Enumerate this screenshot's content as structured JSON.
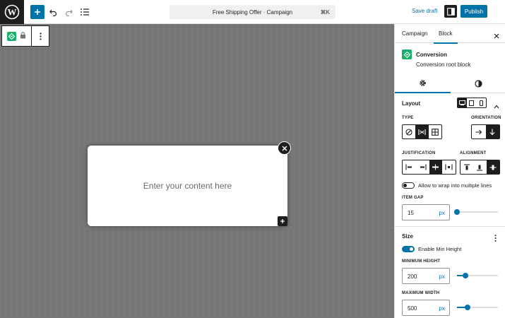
{
  "topbar": {
    "document_title": "Free Shipping Offer · Campaign",
    "shortcut": "⌘K",
    "save_draft": "Save draft",
    "publish": "Publish"
  },
  "canvas": {
    "popup_placeholder": "Enter your content here"
  },
  "sidebar": {
    "tabs": [
      {
        "label": "Campaign",
        "active": false
      },
      {
        "label": "Block",
        "active": true
      }
    ],
    "block": {
      "name": "Conversion",
      "description": "Conversion root block"
    },
    "layout": {
      "title": "Layout",
      "device": "desktop",
      "type_label": "TYPE",
      "type_selected": "flex",
      "orientation_label": "ORIENTATION",
      "orientation_selected": "vertical",
      "justification_label": "JUSTIFICATION",
      "justification_selected": "center",
      "alignment_label": "ALIGNMENT",
      "alignment_selected": "stretch",
      "wrap_label": "Allow to wrap into multiple lines",
      "wrap_enabled": false,
      "gap_label": "ITEM GAP",
      "gap_value": "15",
      "gap_unit": "px",
      "gap_slider": 0.0
    },
    "size": {
      "title": "Size",
      "min_height_toggle_label": "Enable Min Height",
      "min_height_enabled": true,
      "min_height_label": "MINIMUM HEIGHT",
      "min_height_value": "200",
      "min_height_unit": "px",
      "min_height_slider": 0.2,
      "max_width_label": "MAXIMUM WIDTH",
      "max_width_value": "500",
      "max_width_unit": "px",
      "max_width_slider": 0.25
    }
  },
  "colors": {
    "accent": "#0073aa",
    "dark": "#1e1e1e",
    "brand_green": "#17b26a"
  }
}
